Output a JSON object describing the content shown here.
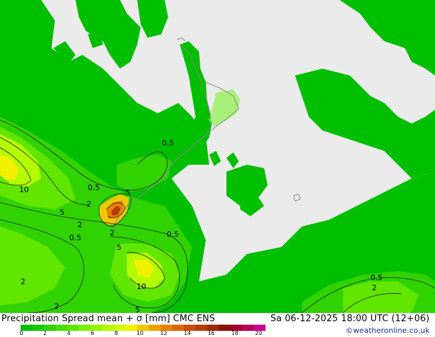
{
  "title": "Precipitation Spread mean + σ [mm] CMC ENS",
  "datetime": "Sa 06-12-2025 18:00 UTC (12+06)",
  "credit": "©weatheronline.co.uk",
  "legend": {
    "colors": [
      "#00be00",
      "#18c800",
      "#30d200",
      "#48dc00",
      "#60e600",
      "#78f000",
      "#96f500",
      "#b4fa00",
      "#d2fa00",
      "#f0f000",
      "#f0c800",
      "#f0a000",
      "#e68200",
      "#dc6400",
      "#c85000",
      "#b43c00",
      "#a02800",
      "#8c1400",
      "#a00032",
      "#b4005a",
      "#c8008c"
    ],
    "ticks": [
      "0",
      "2",
      "4",
      "6",
      "8",
      "10",
      "12",
      "14",
      "16",
      "18",
      "20"
    ]
  },
  "contours": {
    "c05a": "0.5",
    "c05b": "0.5",
    "c05c": "0.5",
    "c05d": "0.5",
    "c05e": "0.5",
    "c2a": "2",
    "c2b": "2",
    "c2c": "2",
    "c2d": "2",
    "c2e": "2",
    "c2f": "2",
    "c5a": "5",
    "c5b": "5",
    "c5c": "5",
    "c5d": "5",
    "c10a": "10",
    "c10b": "10"
  }
}
